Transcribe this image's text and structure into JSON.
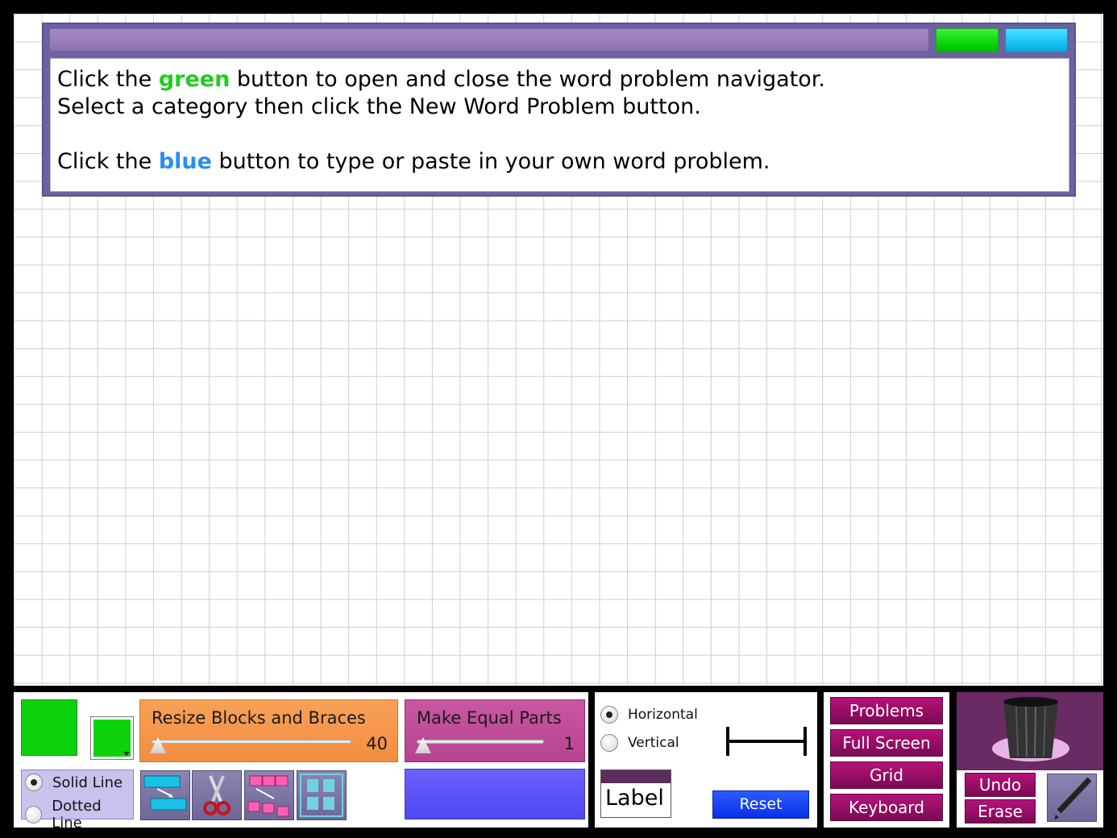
{
  "word_problem": {
    "line1_before": "Click the ",
    "line1_highlight": "green",
    "line1_after": " button to open and close the word problem navigator.",
    "line2": "Select a category then click the New Word Problem button.",
    "line3_before": "Click the ",
    "line3_highlight": "blue",
    "line3_after": " button to type or paste in your own word problem."
  },
  "toolbar": {
    "resize_label": "Resize Blocks and Braces",
    "resize_value": "40",
    "equal_parts_label": "Make Equal Parts",
    "equal_parts_value": "1",
    "solid_line_label": "Solid Line",
    "dotted_line_label": "Dotted Line",
    "horizontal_label": "Horizontal",
    "vertical_label": "Vertical",
    "label_text": "Label",
    "reset_label": "Reset",
    "menu": {
      "problems": "Problems",
      "full_screen": "Full Screen",
      "grid": "Grid",
      "keyboard": "Keyboard"
    },
    "undo_label": "Undo",
    "erase_label": "Erase"
  },
  "colors": {
    "selected_color": "#0cd20c",
    "panel_border": "#6c62a0",
    "menu_button": "#930c63"
  },
  "icons": [
    "duplicate-blocks-icon",
    "scissors-icon",
    "split-blocks-icon",
    "group-blocks-icon",
    "brace-icon",
    "trash-icon",
    "pencil-icon"
  ]
}
